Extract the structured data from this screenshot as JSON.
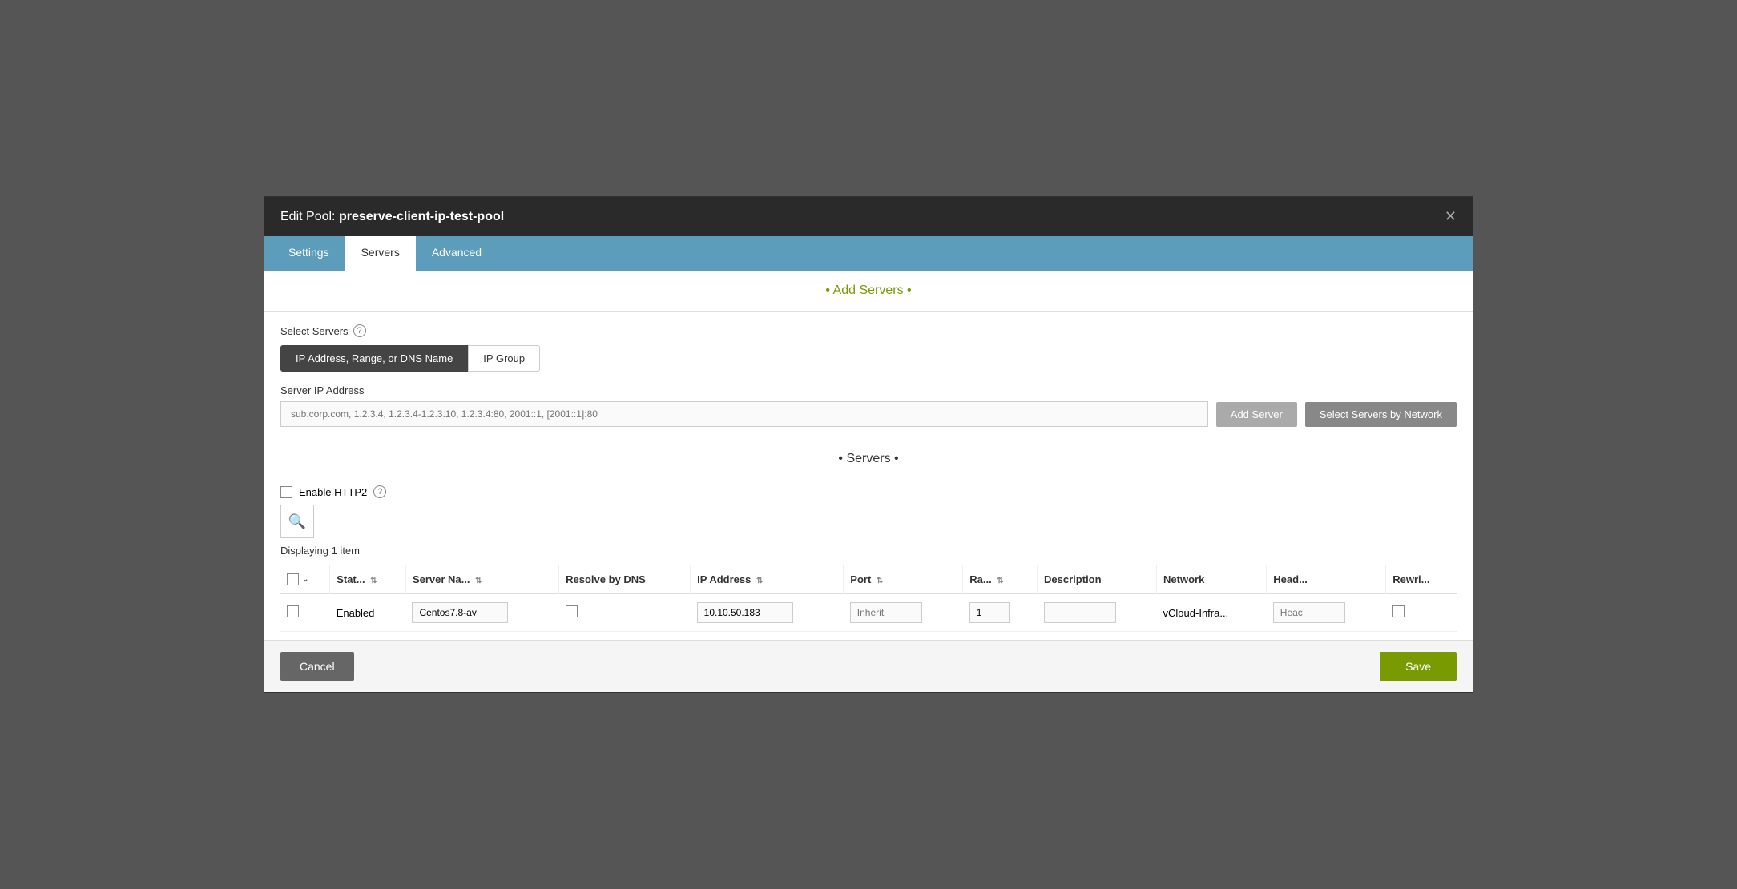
{
  "modal": {
    "title_prefix": "Edit Pool: ",
    "title_bold": "preserve-client-ip-test-pool"
  },
  "tabs": [
    {
      "label": "Settings",
      "active": false
    },
    {
      "label": "Servers",
      "active": true
    },
    {
      "label": "Advanced",
      "active": false
    }
  ],
  "add_servers_section": {
    "title": "• Add Servers •",
    "select_servers_label": "Select Servers",
    "toggle_options": [
      {
        "label": "IP Address, Range, or DNS Name",
        "active": true
      },
      {
        "label": "IP Group",
        "active": false
      }
    ],
    "server_ip_label": "Server IP Address",
    "server_ip_placeholder": "sub.corp.com, 1.2.3.4, 1.2.3.4-1.2.3.10, 1.2.3.4:80, 2001::1, [2001::1]:80",
    "add_server_btn": "Add Server",
    "select_servers_by_network_btn": "Select Servers by Network"
  },
  "servers_section": {
    "title": "• Servers •",
    "enable_http2_label": "Enable HTTP2",
    "displaying_text": "Displaying 1 item",
    "table": {
      "columns": [
        {
          "label": "Stat...",
          "sortable": true
        },
        {
          "label": "Server Na...",
          "sortable": true
        },
        {
          "label": "Resolve by DNS",
          "sortable": false
        },
        {
          "label": "IP Address",
          "sortable": true
        },
        {
          "label": "Port",
          "sortable": true
        },
        {
          "label": "Ra...",
          "sortable": true
        },
        {
          "label": "Description",
          "sortable": false
        },
        {
          "label": "Network",
          "sortable": false
        },
        {
          "label": "Head...",
          "sortable": false
        },
        {
          "label": "Rewri...",
          "sortable": false
        }
      ],
      "rows": [
        {
          "status": "Enabled",
          "server_name": "Centos7.8-av",
          "resolve_by_dns": false,
          "ip_address": "10.10.50.183",
          "port_placeholder": "Inherit",
          "ratio": "1",
          "description": "",
          "network": "vCloud-Infra...",
          "head": "Heac",
          "rewrite": false
        }
      ]
    }
  },
  "footer": {
    "cancel_label": "Cancel",
    "save_label": "Save"
  },
  "icons": {
    "close": "✕",
    "search": "🔍",
    "sort": "⇅",
    "chevron_down": "∨",
    "help": "?"
  }
}
